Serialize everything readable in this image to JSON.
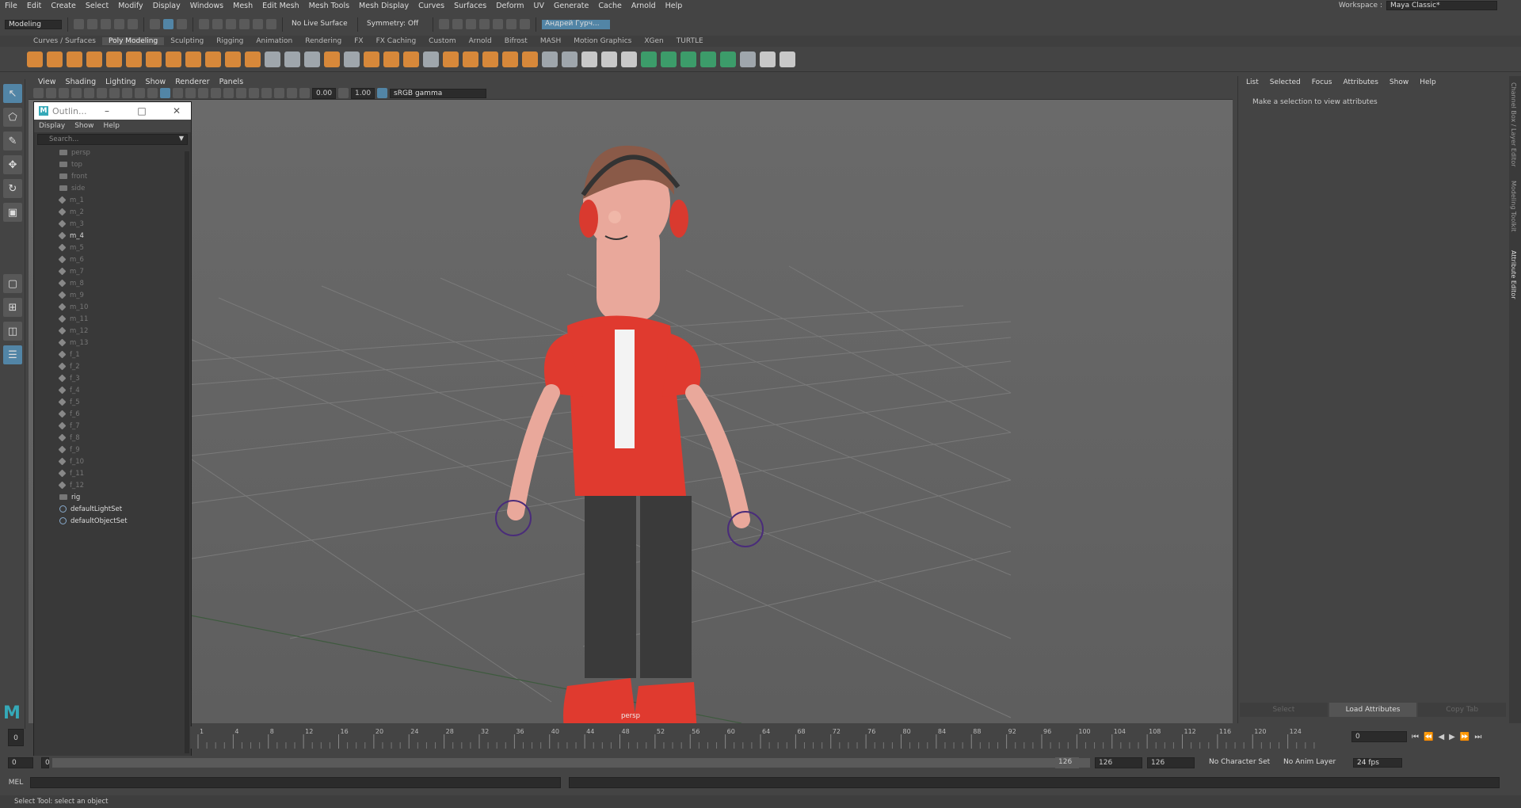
{
  "menubar": {
    "items": [
      "File",
      "Edit",
      "Create",
      "Select",
      "Modify",
      "Display",
      "Windows",
      "Mesh",
      "Edit Mesh",
      "Mesh Tools",
      "Mesh Display",
      "Curves",
      "Surfaces",
      "Deform",
      "UV",
      "Generate",
      "Cache",
      "Arnold",
      "Help"
    ],
    "workspace_label": "Workspace :",
    "workspace_value": "Maya Classic*"
  },
  "statusline": {
    "mode": "Modeling",
    "live_surface": "No Live Surface",
    "symmetry": "Symmetry: Off",
    "user": "Андрей Гурч..."
  },
  "shelf": {
    "tabs": [
      "Curves / Surfaces",
      "Poly Modeling",
      "Sculpting",
      "Rigging",
      "Animation",
      "Rendering",
      "FX",
      "FX Caching",
      "Custom",
      "Arnold",
      "Bifrost",
      "MASH",
      "Motion Graphics",
      "XGen",
      "TURTLE"
    ],
    "active_tab": "Poly Modeling"
  },
  "viewport": {
    "menu": [
      "View",
      "Shading",
      "Lighting",
      "Show",
      "Renderer",
      "Panels"
    ],
    "exposure": "0.00",
    "gamma": "1.00",
    "color_space": "sRGB gamma",
    "camera": "persp"
  },
  "outliner": {
    "title": "Outlin...",
    "menu": [
      "Display",
      "Show",
      "Help"
    ],
    "search_placeholder": "Search...",
    "items": [
      {
        "name": "persp",
        "type": "camera",
        "dim": true
      },
      {
        "name": "top",
        "type": "camera",
        "dim": true
      },
      {
        "name": "front",
        "type": "camera",
        "dim": true
      },
      {
        "name": "side",
        "type": "camera",
        "dim": true
      },
      {
        "name": "m_1",
        "type": "mesh",
        "dim": true
      },
      {
        "name": "m_2",
        "type": "mesh",
        "dim": true
      },
      {
        "name": "m_3",
        "type": "mesh",
        "dim": true
      },
      {
        "name": "m_4",
        "type": "mesh",
        "dim": false
      },
      {
        "name": "m_5",
        "type": "mesh",
        "dim": true
      },
      {
        "name": "m_6",
        "type": "mesh",
        "dim": true
      },
      {
        "name": "m_7",
        "type": "mesh",
        "dim": true
      },
      {
        "name": "m_8",
        "type": "mesh",
        "dim": true
      },
      {
        "name": "m_9",
        "type": "mesh",
        "dim": true
      },
      {
        "name": "m_10",
        "type": "mesh",
        "dim": true
      },
      {
        "name": "m_11",
        "type": "mesh",
        "dim": true
      },
      {
        "name": "m_12",
        "type": "mesh",
        "dim": true
      },
      {
        "name": "m_13",
        "type": "mesh",
        "dim": true
      },
      {
        "name": "f_1",
        "type": "mesh",
        "dim": true
      },
      {
        "name": "f_2",
        "type": "mesh",
        "dim": true
      },
      {
        "name": "f_3",
        "type": "mesh",
        "dim": true
      },
      {
        "name": "f_4",
        "type": "mesh",
        "dim": true
      },
      {
        "name": "f_5",
        "type": "mesh",
        "dim": true
      },
      {
        "name": "f_6",
        "type": "mesh",
        "dim": true
      },
      {
        "name": "f_7",
        "type": "mesh",
        "dim": true
      },
      {
        "name": "f_8",
        "type": "mesh",
        "dim": true
      },
      {
        "name": "f_9",
        "type": "mesh",
        "dim": true
      },
      {
        "name": "f_10",
        "type": "mesh",
        "dim": true
      },
      {
        "name": "f_11",
        "type": "mesh",
        "dim": true
      },
      {
        "name": "f_12",
        "type": "mesh",
        "dim": true
      },
      {
        "name": "rig",
        "type": "joint",
        "dim": false
      },
      {
        "name": "defaultLightSet",
        "type": "set",
        "dim": false
      },
      {
        "name": "defaultObjectSet",
        "type": "set",
        "dim": false
      }
    ]
  },
  "attribute_editor": {
    "menu": [
      "List",
      "Selected",
      "Focus",
      "Attributes",
      "Show",
      "Help"
    ],
    "message": "Make a selection to view attributes",
    "buttons": [
      "Select",
      "Load Attributes",
      "Copy Tab"
    ],
    "side_tabs": [
      "Channel Box / Layer Editor",
      "Modeling Toolkit",
      "Attribute Editor"
    ]
  },
  "timeline": {
    "ticks": [
      "1",
      "4",
      "8",
      "12",
      "16",
      "20",
      "24",
      "28",
      "32",
      "36",
      "40",
      "44",
      "48",
      "52",
      "56",
      "60",
      "64",
      "68",
      "72",
      "76",
      "80",
      "84",
      "88",
      "92",
      "96",
      "100",
      "104",
      "108",
      "112",
      "116",
      "120",
      "124"
    ],
    "current_frame": "0",
    "frame_field": "0"
  },
  "range": {
    "start": "0",
    "start_inner": "0",
    "end_inner": "126",
    "end_outer": "126",
    "end_outer2": "126",
    "character_set": "No Character Set",
    "anim_layer": "No Anim Layer",
    "fps": "24 fps"
  },
  "commandline": {
    "lang": "MEL"
  },
  "helpline": {
    "text": "Select Tool: select an object"
  }
}
